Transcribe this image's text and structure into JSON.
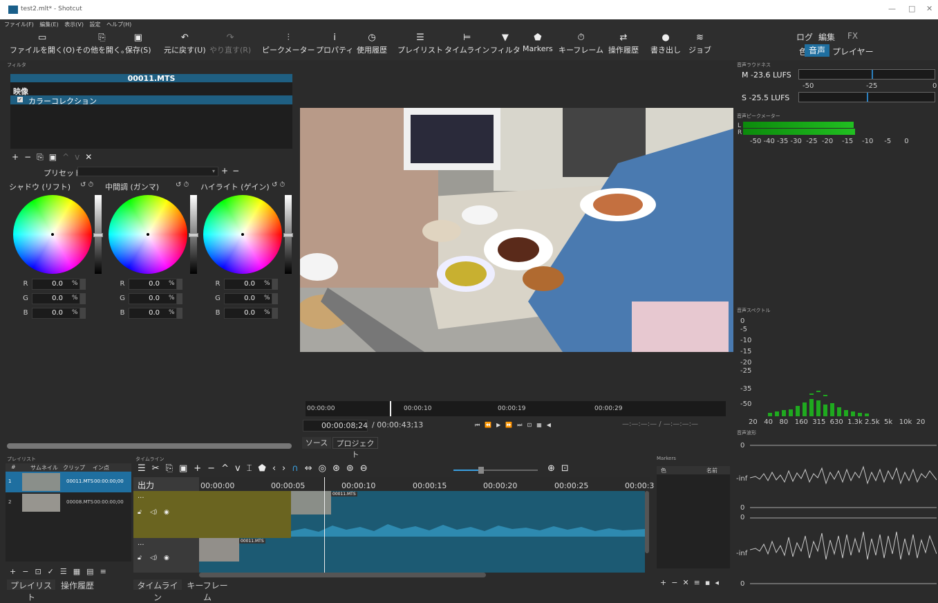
{
  "window": {
    "title": "test2.mlt* - Shotcut",
    "min": "—",
    "max": "□",
    "close": "✕"
  },
  "menu": [
    "ファイル(F)",
    "編集(E)",
    "表示(V)",
    "設定",
    "ヘルプ(H)"
  ],
  "toolbar": [
    {
      "icon": "folder-open-icon",
      "glyph": "▭",
      "label": "ファイルを開く(O)"
    },
    {
      "icon": "open-other-icon",
      "glyph": "⎘",
      "label": "その他を開く。"
    },
    {
      "icon": "save-icon",
      "glyph": "▣",
      "label": "保存(S)"
    },
    {
      "icon": "undo-icon",
      "glyph": "↶",
      "label": "元に戻す(U)"
    },
    {
      "icon": "redo-icon",
      "glyph": "↷",
      "label": "やり直す(R)"
    },
    {
      "icon": "peak-meter-icon",
      "glyph": "⫶",
      "label": "ピークメーター"
    },
    {
      "icon": "info-icon",
      "glyph": "i",
      "label": "プロパティ"
    },
    {
      "icon": "history-icon",
      "glyph": "◷",
      "label": "使用履歴"
    },
    {
      "icon": "playlist-icon",
      "glyph": "☰",
      "label": "プレイリスト"
    },
    {
      "icon": "timeline-icon",
      "glyph": "⊨",
      "label": "タイムライン"
    },
    {
      "icon": "filter-icon",
      "glyph": "▼",
      "label": "フィルタ"
    },
    {
      "icon": "marker-icon",
      "glyph": "⬟",
      "label": "Markers"
    },
    {
      "icon": "stopwatch-icon",
      "glyph": "⏱",
      "label": "キーフレーム"
    },
    {
      "icon": "operation-history-icon",
      "glyph": "⇄",
      "label": "操作履歴"
    },
    {
      "icon": "export-icon",
      "glyph": "●",
      "label": "書き出し"
    },
    {
      "icon": "jobs-icon",
      "glyph": "≋",
      "label": "ジョブ"
    }
  ],
  "layouts": {
    "log": "ログ",
    "edit": "編集",
    "fx": "FX",
    "color": "色",
    "audio": "音声",
    "player": "プレイヤー"
  },
  "filter_panel": {
    "header": "フィルタ",
    "clip": "00011.MTS",
    "category": "映像",
    "item": "カラーコレクション",
    "preset_label": "プリセット",
    "wheels": [
      {
        "title": "シャドウ (リフト)",
        "r": "0.0",
        "g": "0.0",
        "b": "0.0"
      },
      {
        "title": "中間調 (ガンマ)",
        "r": "0.0",
        "g": "0.0",
        "b": "0.0"
      },
      {
        "title": "ハイライト (ゲイン)",
        "r": "0.0",
        "g": "0.0",
        "b": "0.0"
      }
    ],
    "r": "R",
    "g": "G",
    "b": "B",
    "pct": "%"
  },
  "player": {
    "ticks": [
      "00:00:00",
      "00:00:10",
      "00:00:19",
      "00:00:29"
    ],
    "current": "00:00:08;24",
    "total": "/ 00:00:43;13",
    "in_out": "—:—:—:— /  —:—:—:—",
    "tabs": [
      "ソース",
      "プロジェクト"
    ]
  },
  "loudness": {
    "header": "音声ラウドネス",
    "m": "M  -23.6 LUFS",
    "s": "S  -25.5 LUFS",
    "scale": [
      "-50",
      "-25",
      "0"
    ]
  },
  "peak": {
    "header": "音声ピークメーター",
    "l": "L",
    "r": "R",
    "scale": "-50 -40 -35 -30  -25  -20    -15    -10     -5      0"
  },
  "spectrum": {
    "header": "音声スペクトル",
    "db": [
      "0",
      "-5",
      "-10",
      "-15",
      "-20",
      "-25",
      "-35",
      "-50"
    ],
    "freq": "20   40   80   160  315  630  1.3k 2.5k  5k   10k  20"
  },
  "waveform": {
    "header": "音声波形",
    "labels": [
      "0",
      "-inf",
      "0",
      "0",
      "-inf",
      "0"
    ]
  },
  "playlist": {
    "header": "プレイリスト",
    "cols": [
      "#",
      "サムネイル",
      "クリップ",
      "イン点"
    ],
    "rows": [
      {
        "n": "1",
        "clip": "00011.MTS",
        "in": "00:00:00;00"
      },
      {
        "n": "2",
        "clip": "00008.MTS",
        "in": "00:00:00;00"
      }
    ],
    "tabs": [
      "プレイリスト",
      "操作履歴"
    ]
  },
  "timeline": {
    "header": "タイムライン",
    "output": "出力",
    "ticks": [
      "00:00:00",
      "00:00:05",
      "00:00:10",
      "00:00:15",
      "00:00:20",
      "00:00:25",
      "00:00:3"
    ],
    "clip_v1": "00011.MTS",
    "clip_a1": "00011.MTS",
    "dots": "...",
    "tabs": [
      "タイムライン",
      "キーフレーム"
    ]
  },
  "markers": {
    "header": "Markers",
    "col_color": "色",
    "col_name": "名前"
  }
}
